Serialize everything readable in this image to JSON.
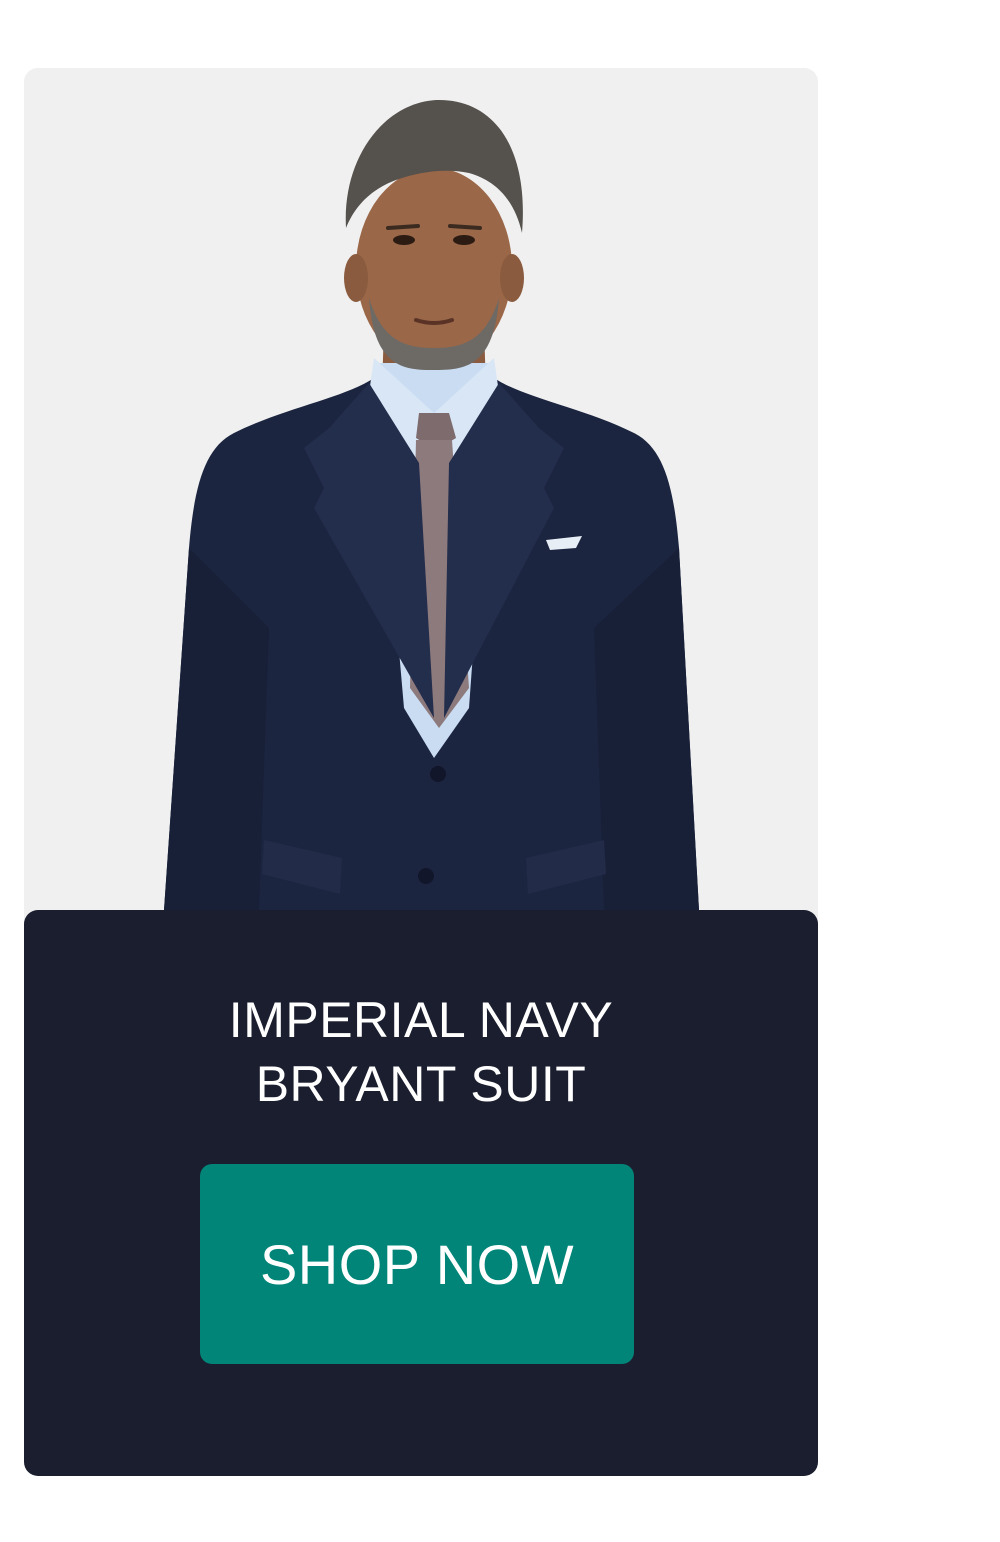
{
  "product": {
    "title_line1": "IMPERIAL NAVY",
    "title_line2": "BRYANT SUIT"
  },
  "cta": {
    "label": "SHOP NOW"
  },
  "colors": {
    "photo_background": "#f0f0f0",
    "panel_background": "#1a1e2e",
    "button_background": "#008578",
    "text": "#ffffff",
    "suit": "#1c2540"
  },
  "image": {
    "subject": "model-in-navy-suit-icon"
  }
}
